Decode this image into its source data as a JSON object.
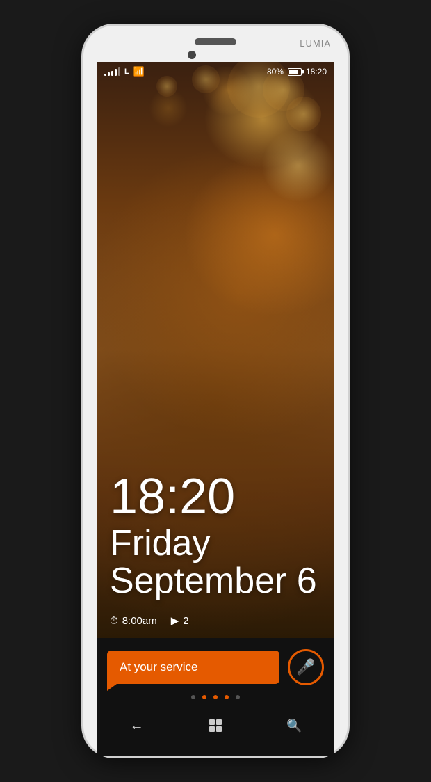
{
  "phone": {
    "brand": "LUMIA",
    "status": {
      "signal_bars": [
        3,
        5,
        8,
        11,
        14
      ],
      "network": "L",
      "battery_percent": "80%",
      "time": "18:20"
    },
    "clock": {
      "time": "18:20",
      "day": "Friday",
      "date": "September 6"
    },
    "notifications": {
      "alarm_time": "8:00am",
      "message_count": "2"
    },
    "cortana": {
      "speech_text": "At your service",
      "mic_label": "microphone"
    },
    "dots": [
      {
        "active": false
      },
      {
        "active": false
      },
      {
        "active": true
      },
      {
        "active": false
      },
      {
        "active": false
      },
      {
        "active": false
      }
    ],
    "nav": {
      "back_label": "←",
      "home_label": "⊞",
      "search_label": "⌕"
    }
  }
}
